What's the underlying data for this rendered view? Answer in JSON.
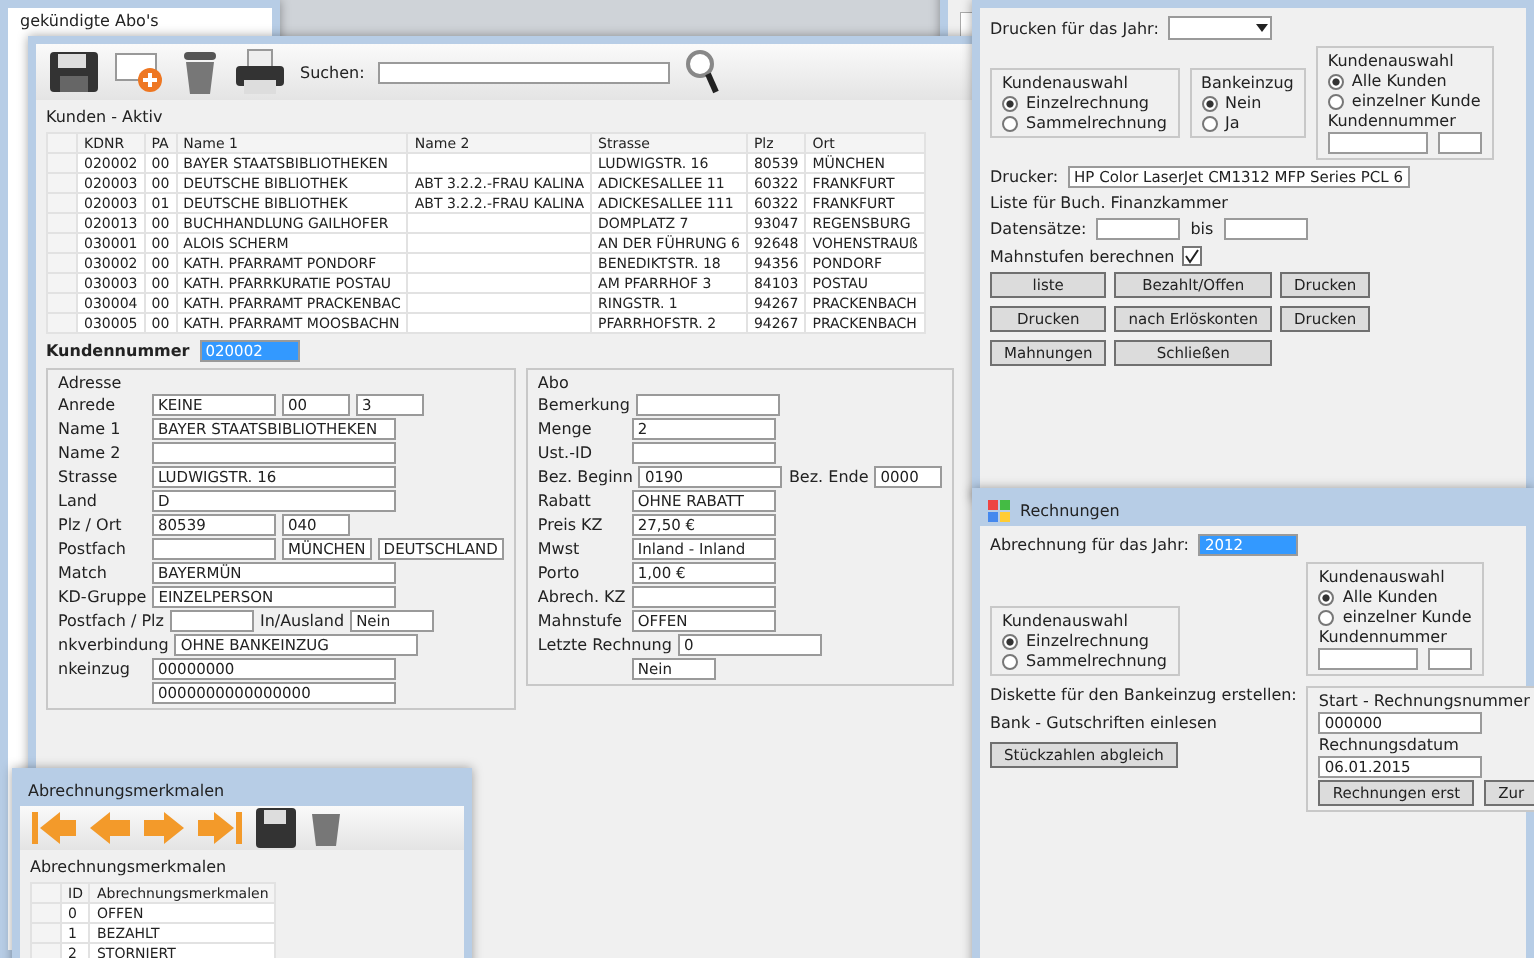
{
  "back_window": {
    "sidebar_items": [
      {
        "label": "gekündigte Abo's"
      }
    ]
  },
  "print_window": {
    "year_label": "Drucken für das Jahr:",
    "selection": {
      "title": "Kundenauswahl",
      "options": [
        {
          "label": "Einzelrechnung",
          "selected": true
        },
        {
          "label": "Sammelrechnung",
          "selected": false
        }
      ]
    },
    "bank_debit": {
      "title": "Bankeinzug",
      "options": [
        {
          "label": "Nein",
          "selected": true
        },
        {
          "label": "Ja",
          "selected": false
        }
      ]
    },
    "customers": {
      "title": "Kundenauswahl",
      "options": [
        {
          "label": "Alle Kunden",
          "selected": true
        },
        {
          "label": "einzelner Kunde",
          "selected": false
        }
      ],
      "number_label": "Kundennummer"
    },
    "printer_label": "Drucker:",
    "printer_value": "HP Color LaserJet CM1312 MFP Series PCL 6",
    "list_label": "Liste für Buch. Finanzkammer",
    "records_label": "Datensätze:",
    "to_label": "bis",
    "dunning": {
      "label": "Mahnstufen berechnen",
      "checked": true
    },
    "buttons": [
      {
        "label": "liste"
      },
      {
        "label": "Bezahlt/Offen"
      },
      {
        "label": "Drucken"
      },
      {
        "label": "Drucken"
      },
      {
        "label": "nach Erlöskonten"
      },
      {
        "label": "Drucken"
      },
      {
        "label": "Mahnungen"
      },
      {
        "label": "Schließen"
      }
    ]
  },
  "customers_window": {
    "grid_title": "Kunden - Aktiv",
    "search_label": "Suchen:",
    "columns": [
      "KDNR",
      "PA",
      "Name 1",
      "Name 2",
      "Strasse",
      "Plz",
      "Ort"
    ],
    "rows": [
      [
        "020002",
        "00",
        "BAYER STAATSBIBLIOTHEKEN",
        "",
        "LUDWIGSTR. 16",
        "80539",
        "MÜNCHEN"
      ],
      [
        "020003",
        "00",
        "DEUTSCHE BIBLIOTHEK",
        "ABT 3.2.2.-FRAU KALINA",
        "ADICKESALLEE 11",
        "60322",
        "FRANKFURT"
      ],
      [
        "020003",
        "01",
        "DEUTSCHE BIBLIOTHEK",
        "ABT 3.2.2.-FRAU KALINA",
        "ADICKESALLEE 111",
        "60322",
        "FRANKFURT"
      ],
      [
        "020013",
        "00",
        "BUCHHANDLUNG GAILHOFER",
        "",
        "DOMPLATZ 7",
        "93047",
        "REGENSBURG"
      ],
      [
        "030001",
        "00",
        "ALOIS SCHERM",
        "",
        "AN DER FÜHRUNG 6",
        "92648",
        "VOHENSTRAUß"
      ],
      [
        "030002",
        "00",
        "KATH. PFARRAMT PONDORF",
        "",
        "BENEDIKTSTR. 18",
        "94356",
        "PONDORF"
      ],
      [
        "030003",
        "00",
        "KATH. PFARRKURATIE POSTAU",
        "",
        "AM PFARRHOF 3",
        "84103",
        "POSTAU"
      ],
      [
        "030004",
        "00",
        "KATH. PFARRAMT PRACKENBAC",
        "",
        "RINGSTR. 1",
        "94267",
        "PRACKENBACH"
      ],
      [
        "030005",
        "00",
        "KATH. PFARRAMT MOOSBACHN",
        "",
        "PFARRHOFSTR. 2",
        "94267",
        "PRACKENBACH"
      ]
    ],
    "number_label": "Kundennummer",
    "number_value": "020002",
    "address_title": "Adresse",
    "address_fields": [
      {
        "label": "Anrede",
        "value": "KEINE",
        "extra": [
          "00",
          "3"
        ]
      },
      {
        "label": "Name 1",
        "value": "BAYER STAATSBIBLIOTHEKEN"
      },
      {
        "label": "Name 2"
      },
      {
        "label": "Strasse",
        "value": "LUDWIGSTR. 16"
      },
      {
        "label": "Land",
        "value": "D"
      },
      {
        "label": "Plz / Ort",
        "value": "80539",
        "extra": [
          "040"
        ]
      },
      {
        "label": "Postfach",
        "extra": [
          "MÜNCHEN",
          "DEUTSCHLAND"
        ]
      },
      {
        "label": "Match",
        "value": "BAYERMÜN"
      },
      {
        "label": "KD-Gruppe",
        "value": "EINZELPERSON"
      }
    ],
    "postbox_label": "Postfach / Plz",
    "abroad_label": "In/Ausland",
    "abroad_value": "Nein",
    "bank_labels": [
      "nkverbindung",
      "nkeinzug"
    ],
    "bank_values": [
      "OHNE BANKEINZUG",
      "00000000",
      "0000000000000000"
    ],
    "abo_title": "Abo",
    "abo_fields": [
      {
        "label": "Bemerkung"
      },
      {
        "label": "Menge",
        "value": "2"
      },
      {
        "label": "Ust.-ID"
      },
      {
        "label": "Bez. Beginn",
        "value": "0190",
        "extra_label": "Bez. Ende",
        "extra": "0000"
      },
      {
        "label": "Rabatt",
        "value": "OHNE RABATT"
      },
      {
        "label": "Preis KZ",
        "value": "27,50 €"
      },
      {
        "label": "Mwst",
        "value": "Inland - Inland"
      },
      {
        "label": "Porto",
        "value": "1,00 €"
      },
      {
        "label": "Abrech. KZ"
      },
      {
        "label": "Mahnstufe",
        "value": "OFFEN"
      },
      {
        "label": "Letzte Rechnung",
        "value": "0"
      }
    ],
    "last_value": "Nein"
  },
  "features_window": {
    "title": "Abrechnungsmerkmalen",
    "grid_title": "Abrechnungsmerkmalen",
    "columns": [
      "ID",
      "Abrechnungsmerkmalen"
    ],
    "rows": [
      [
        "0",
        "OFFEN"
      ],
      [
        "1",
        "BEZAHLT"
      ],
      [
        "2",
        "STORNIERT"
      ]
    ]
  },
  "invoice_window": {
    "title": "Rechnungen",
    "year_label": "Abrechnung für das Jahr:",
    "year_value": "2012",
    "selection": {
      "title": "Kundenauswahl",
      "options": [
        {
          "label": "Einzelrechnung",
          "selected": true
        },
        {
          "label": "Sammelrechnung",
          "selected": false
        }
      ]
    },
    "customers": {
      "title": "Kundenauswahl",
      "options": [
        {
          "label": "Alle Kunden",
          "selected": true
        },
        {
          "label": "einzelner Kunde",
          "selected": false
        }
      ],
      "number_label": "Kundennummer"
    },
    "disk_label": "Diskette für den Bankeinzug erstellen:",
    "bank_label": "Bank - Gutschriften einlesen",
    "count_button": "Stückzahlen abgleich",
    "start_label": "Start - Rechnungsnummer",
    "start_value": "000000",
    "date_label": "Rechnungsdatum",
    "date_value": "06.01.2015",
    "buttons": [
      "Rechnungen erst",
      "Zur"
    ]
  }
}
